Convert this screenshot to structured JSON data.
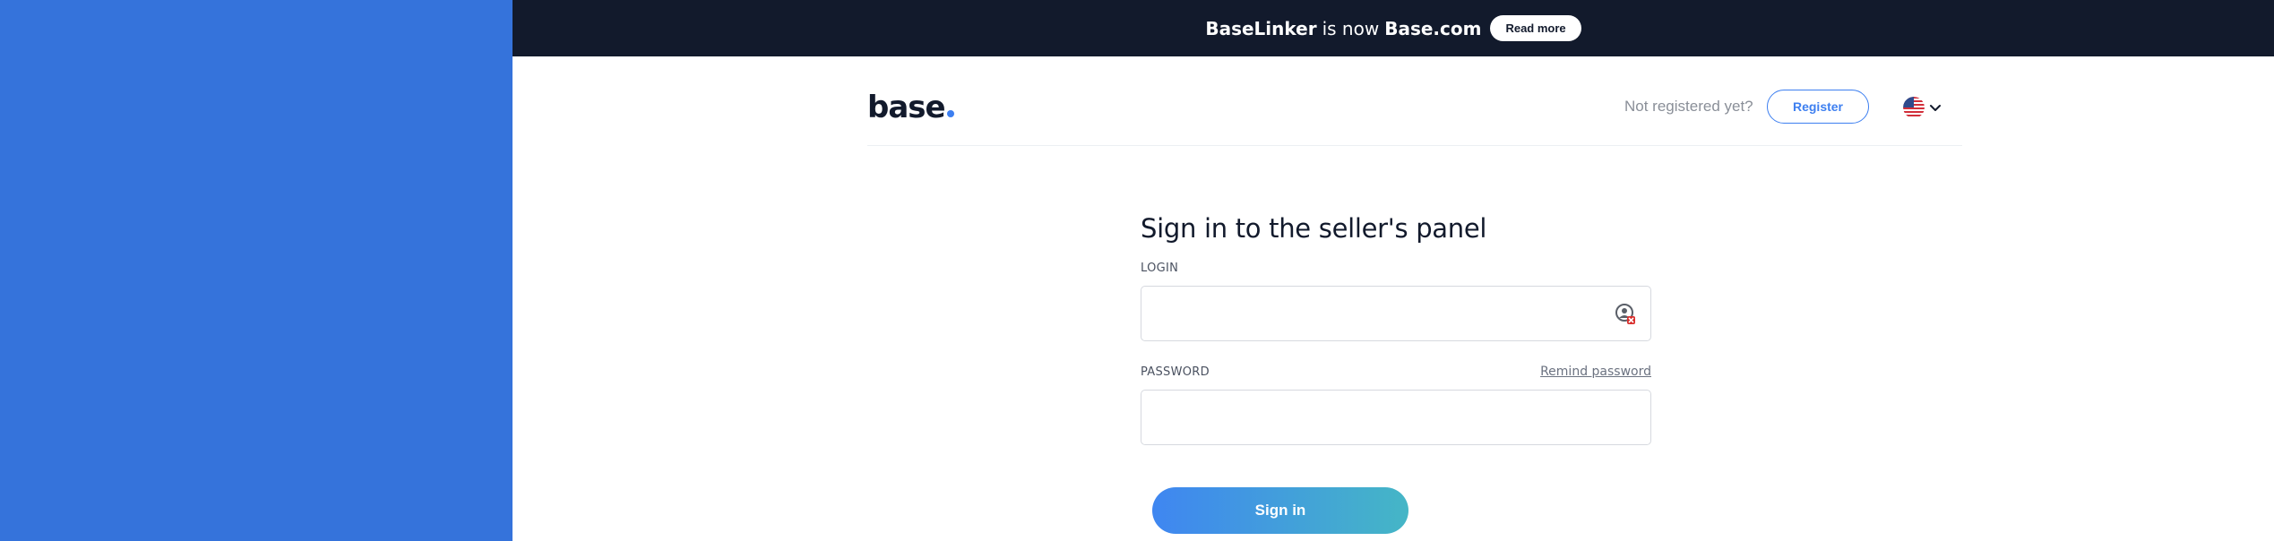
{
  "banner": {
    "brand_old": "BaseLinker",
    "middle": "is now",
    "brand_new": "Base.com",
    "read_more": "Read more"
  },
  "header": {
    "logo_text": "base",
    "not_registered": "Not registered yet?",
    "register": "Register",
    "language_icon": "us-flag-icon"
  },
  "form": {
    "title": "Sign in to the seller's panel",
    "login_label": "LOGIN",
    "login_value": "",
    "password_label": "PASSWORD",
    "password_value": "",
    "remind_password": "Remind password",
    "sign_in": "Sign in"
  },
  "colors": {
    "left_panel": "#3573db",
    "banner_bg": "#121a2c",
    "accent": "#3d7ff0",
    "button_gradient_start": "#3f86f1",
    "button_gradient_end": "#45b6c6"
  }
}
